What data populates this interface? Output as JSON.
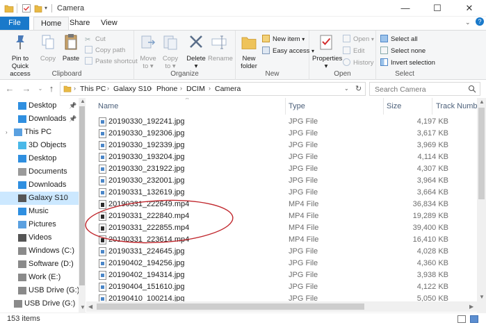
{
  "window": {
    "title": "Camera",
    "minimize_glyph": "—",
    "maximize_glyph": "☐",
    "close_glyph": "✕"
  },
  "ribbon_tabs": [
    "File",
    "Home",
    "Share",
    "View"
  ],
  "ribbon": {
    "clipboard": {
      "label": "Clipboard",
      "pin_label_1": "Pin to Quick",
      "pin_label_2": "access",
      "copy": "Copy",
      "paste": "Paste",
      "cut": "Cut",
      "copy_path": "Copy path",
      "paste_shortcut": "Paste shortcut"
    },
    "organize": {
      "label": "Organize",
      "move_to_1": "Move",
      "move_to_2": "to",
      "copy_to_1": "Copy",
      "copy_to_2": "to",
      "delete": "Delete",
      "rename": "Rename"
    },
    "new": {
      "label": "New",
      "new_folder_1": "New",
      "new_folder_2": "folder",
      "new_item": "New item",
      "easy_access": "Easy access"
    },
    "open": {
      "label": "Open",
      "properties": "Properties",
      "open": "Open",
      "edit": "Edit",
      "history": "History"
    },
    "select": {
      "label": "Select",
      "select_all": "Select all",
      "select_none": "Select none",
      "invert_selection": "Invert selection"
    }
  },
  "breadcrumb": [
    "This PC",
    "Galaxy S10",
    "Phone",
    "DCIM",
    "Camera"
  ],
  "search": {
    "placeholder": "Search Camera"
  },
  "nav_pane": {
    "items": [
      {
        "label": "Desktop",
        "icon": "desktop-icon",
        "pinned": true
      },
      {
        "label": "Downloads",
        "icon": "downloads-icon",
        "pinned": true
      },
      {
        "label": "This PC",
        "icon": "pc-icon",
        "pinned": false
      },
      {
        "label": "3D Objects",
        "icon": "objects-3d-icon",
        "pinned": false
      },
      {
        "label": "Desktop",
        "icon": "desktop-icon",
        "pinned": false
      },
      {
        "label": "Documents",
        "icon": "documents-icon",
        "pinned": false
      },
      {
        "label": "Downloads",
        "icon": "downloads-icon",
        "pinned": false
      },
      {
        "label": "Galaxy S10",
        "icon": "phone-icon",
        "pinned": false
      },
      {
        "label": "Music",
        "icon": "music-icon",
        "pinned": false
      },
      {
        "label": "Pictures",
        "icon": "pictures-icon",
        "pinned": false
      },
      {
        "label": "Videos",
        "icon": "videos-icon",
        "pinned": false
      },
      {
        "label": "Windows (C:)",
        "icon": "drive-icon",
        "pinned": false
      },
      {
        "label": "Software (D:)",
        "icon": "drive-icon",
        "pinned": false
      },
      {
        "label": "Work (E:)",
        "icon": "drive-icon",
        "pinned": false
      },
      {
        "label": "USB Drive (G:)",
        "icon": "usb-drive-icon",
        "pinned": false
      },
      {
        "label": "USB Drive (G:)",
        "icon": "usb-drive-icon",
        "pinned": false
      }
    ]
  },
  "columns": {
    "name": "Name",
    "type": "Type",
    "size": "Size",
    "track": "Track Number"
  },
  "files": [
    {
      "name": "20190330_192241.jpg",
      "type": "JPG File",
      "size": "4,197 KB",
      "kind": "jpg"
    },
    {
      "name": "20190330_192306.jpg",
      "type": "JPG File",
      "size": "3,617 KB",
      "kind": "jpg"
    },
    {
      "name": "20190330_192339.jpg",
      "type": "JPG File",
      "size": "3,969 KB",
      "kind": "jpg"
    },
    {
      "name": "20190330_193204.jpg",
      "type": "JPG File",
      "size": "4,114 KB",
      "kind": "jpg"
    },
    {
      "name": "20190330_231922.jpg",
      "type": "JPG File",
      "size": "4,307 KB",
      "kind": "jpg"
    },
    {
      "name": "20190330_232001.jpg",
      "type": "JPG File",
      "size": "3,964 KB",
      "kind": "jpg"
    },
    {
      "name": "20190331_132619.jpg",
      "type": "JPG File",
      "size": "3,664 KB",
      "kind": "jpg"
    },
    {
      "name": "20190331_222649.mp4",
      "type": "MP4 File",
      "size": "36,834 KB",
      "kind": "mp4"
    },
    {
      "name": "20190331_222840.mp4",
      "type": "MP4 File",
      "size": "19,289 KB",
      "kind": "mp4"
    },
    {
      "name": "20190331_222855.mp4",
      "type": "MP4 File",
      "size": "39,400 KB",
      "kind": "mp4"
    },
    {
      "name": "20190331_223614.mp4",
      "type": "MP4 File",
      "size": "16,410 KB",
      "kind": "mp4"
    },
    {
      "name": "20190331_224645.jpg",
      "type": "JPG File",
      "size": "4,028 KB",
      "kind": "jpg"
    },
    {
      "name": "20190402_194256.jpg",
      "type": "JPG File",
      "size": "4,360 KB",
      "kind": "jpg"
    },
    {
      "name": "20190402_194314.jpg",
      "type": "JPG File",
      "size": "3,938 KB",
      "kind": "jpg"
    },
    {
      "name": "20190404_151610.jpg",
      "type": "JPG File",
      "size": "4,122 KB",
      "kind": "jpg"
    },
    {
      "name": "20190410_100214.jpg",
      "type": "JPG File",
      "size": "5,050 KB",
      "kind": "jpg"
    }
  ],
  "status": {
    "item_count": "153 items"
  },
  "colors": {
    "accent": "#1979ca",
    "selection": "#cce8ff",
    "annotation": "#c0262c"
  }
}
